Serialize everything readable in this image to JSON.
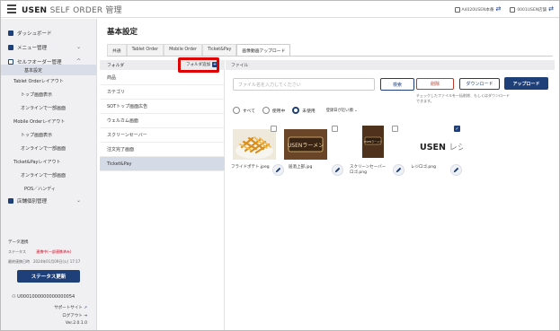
{
  "header": {
    "brand": "USEN",
    "brand_sub": "SELF ORDER 管理",
    "store_label": "A4020USEN本番",
    "account_label": "0001USEN店舗",
    "switch_glyph": "⇄"
  },
  "sidebar": {
    "items": [
      {
        "label": "ダッシュボード",
        "icon": "dashboard-icon"
      },
      {
        "label": "メニュー管理",
        "icon": "menu-icon",
        "chevron": "⌄"
      },
      {
        "label": "セルフオーダー管理",
        "icon": "self-order-icon",
        "chevron": "^"
      }
    ],
    "sub_items": [
      {
        "label": "基本設定",
        "selected": true
      },
      {
        "label": "Tablet Orderレイアウト"
      },
      {
        "label": "トップ画面表示"
      },
      {
        "label": "オンラインで一部画面"
      },
      {
        "label": "Mobile Orderレイアウト"
      },
      {
        "label": "トップ画面表示"
      },
      {
        "label": "オンラインで一部画面"
      },
      {
        "label": "Ticket&Payレイアウト"
      },
      {
        "label": "オンラインで一部画面"
      },
      {
        "label": "POS／ハンディ"
      }
    ],
    "shop_item": {
      "label": "店舗個別管理",
      "icon": "store-icon",
      "chevron": "⌄"
    },
    "data_section_title": "データ連携",
    "status_label": "ステータス",
    "status_value": "連携中(一部連携済み)",
    "last_update": "最終連携日時　2024年01月09日(火) 17:17",
    "status_button": "ステータス更新",
    "user_id": "U0001000000000000054",
    "support_link": "サポートサイト",
    "logout_link": "ログアウト",
    "version": "Ver.2.0.1.0"
  },
  "main": {
    "title": "基本設定",
    "tabs": [
      {
        "label": "共通"
      },
      {
        "label": "Tablet Order"
      },
      {
        "label": "Mobile Order"
      },
      {
        "label": "Ticket&Pay"
      },
      {
        "label": "画像動画アップロード",
        "active": true
      }
    ],
    "folder_header": "フォルダ",
    "folder_add": "フォルダ追加",
    "folders": [
      "商品",
      "カテゴリ",
      "SOTトップ画面広告",
      "ウェルカム画面",
      "スクリーンセーバー",
      "注文完了画面",
      "Ticket&Pay"
    ],
    "selected_folder": "Ticket&Pay",
    "file_header": "ファイル",
    "search_placeholder": "ファイル名を入力してください",
    "search_button": "検索",
    "delete_button": "削除",
    "download_button": "ダウンロード",
    "upload_button": "アップロード",
    "note": "チェックしたファイルを一括削除、もしくはダウンロードできます。",
    "filters": [
      {
        "label": "すべて",
        "selected": false
      },
      {
        "label": "使用中",
        "selected": false
      },
      {
        "label": "未使用",
        "selected": true
      }
    ],
    "sort_label": "登録日が近い順",
    "files": [
      {
        "name": "フライドポテト.jpeg",
        "checked": false
      },
      {
        "name": "居酒上部.jpg",
        "checked": false
      },
      {
        "name": "スクリーンセーバーロゴ.png",
        "checked": false
      },
      {
        "name": "レジロゴ.png",
        "checked": true
      }
    ],
    "logo_text": "USEN",
    "logo_text_2": "レジ",
    "thumb_text_1": "USENラーメン",
    "thumb_text_2": "USENラーメン"
  }
}
